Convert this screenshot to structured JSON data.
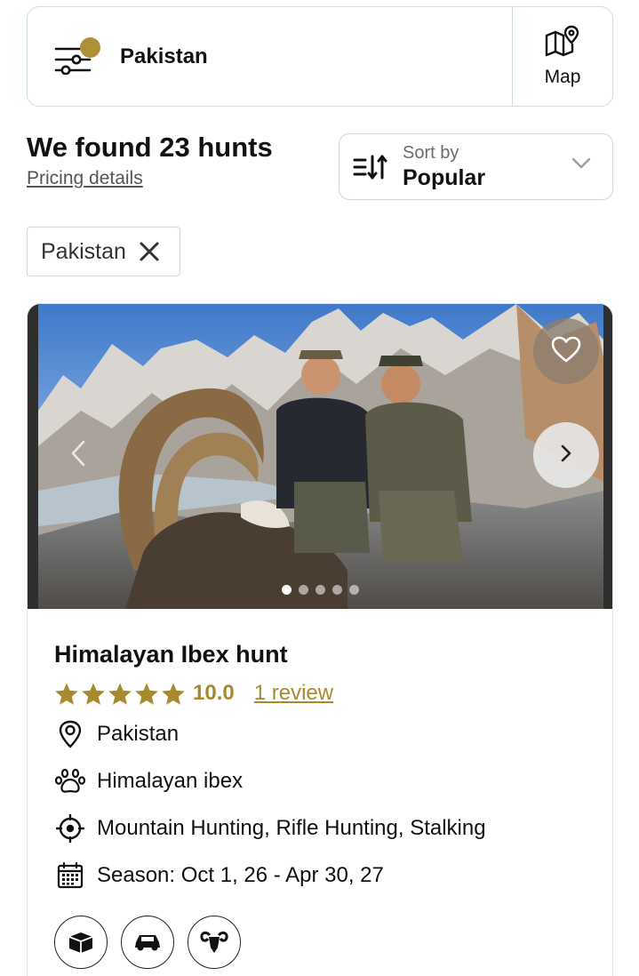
{
  "filter_bar": {
    "location_label": "Pakistan",
    "map_label": "Map",
    "accent_color": "#b09037"
  },
  "results": {
    "title": "We found 23 hunts",
    "pricing_link": "Pricing details"
  },
  "sort": {
    "caption": "Sort by",
    "value": "Popular"
  },
  "active_filters": [
    {
      "label": "Pakistan"
    }
  ],
  "listing": {
    "title": "Himalayan Ibex hunt",
    "rating": "10.0",
    "stars": 5,
    "review_link": "1 review",
    "location": "Pakistan",
    "species": "Himalayan ibex",
    "methods": "Mountain Hunting, Rifle Hunting, Stalking",
    "season": "Season: Oct 1, 26 - Apr 30, 27",
    "gallery_images": 5,
    "gallery_active": 1,
    "feature_icons": [
      "box-icon",
      "car-icon",
      "ram-icon"
    ],
    "rating_color": "#a88a2e"
  }
}
